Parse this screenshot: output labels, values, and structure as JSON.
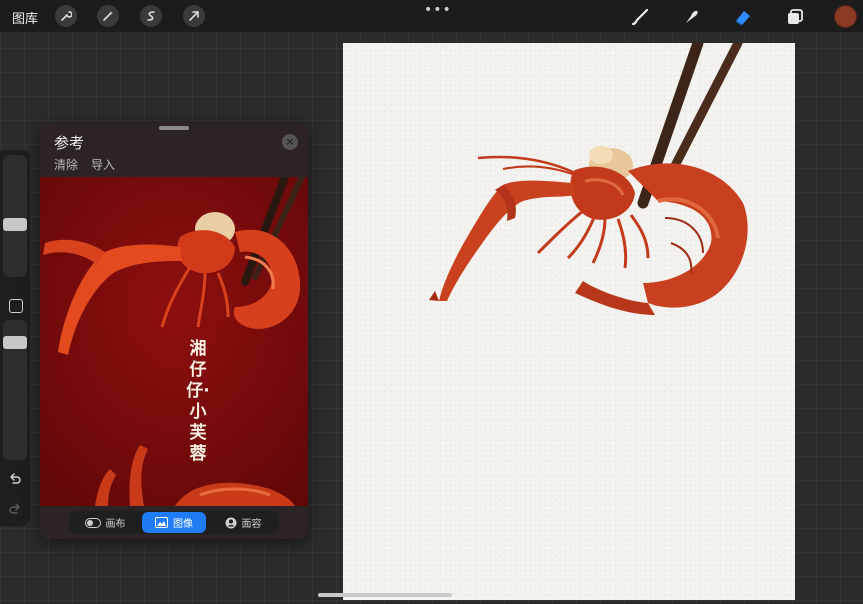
{
  "topbar": {
    "gallery_label": "图库",
    "left_tools": [
      "wrench-icon",
      "magic-wand-icon",
      "selection-icon",
      "transform-arrow-icon"
    ],
    "more": "•••",
    "right_tools": [
      "brush-icon",
      "smudge-icon",
      "eraser-icon",
      "layers-icon"
    ],
    "color": "#8b3a24"
  },
  "reference": {
    "title": "参考",
    "clear_label": "清除",
    "import_label": "导入",
    "overlay_text": "湘仔仔·小芙蓉",
    "tabs": [
      {
        "label": "画布",
        "icon": "canvas-toggle-icon",
        "active": false
      },
      {
        "label": "图像",
        "icon": "image-icon",
        "active": true
      },
      {
        "label": "面容",
        "icon": "face-icon",
        "active": false
      }
    ]
  },
  "colors": {
    "accent": "#1f7cf5",
    "panel": "#2c2424",
    "reference_bg": "#7d0a0a"
  }
}
